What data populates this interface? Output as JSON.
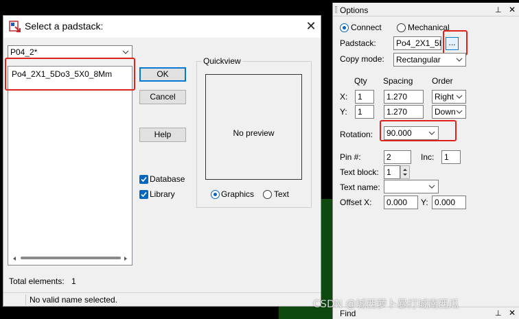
{
  "dialog": {
    "title": "Select a padstack:",
    "filter_value": "P04_2*",
    "list_items": [
      "Po4_2X1_5Do3_5X0_8Mm"
    ],
    "ok_label": "OK",
    "cancel_label": "Cancel",
    "help_label": "Help",
    "database_label": "Database",
    "library_label": "Library",
    "quickview_label": "Quickview",
    "no_preview": "No preview",
    "graphics_label": "Graphics",
    "text_label": "Text",
    "total_label": "Total elements:",
    "total_value": "1",
    "status_text": "No valid name selected.",
    "database_checked": true,
    "library_checked": true,
    "view_mode": "Graphics"
  },
  "options": {
    "title": "Options",
    "connect_label": "Connect",
    "mechanical_label": "Mechanical",
    "mode": "Connect",
    "padstack_label": "Padstack:",
    "padstack_value": "Po4_2X1_5D",
    "browse_label": "...",
    "copy_mode_label": "Copy mode:",
    "copy_mode_value": "Rectangular",
    "qty_header": "Qty",
    "spacing_header": "Spacing",
    "order_header": "Order",
    "x_label": "X:",
    "y_label": "Y:",
    "x_qty": "1",
    "y_qty": "1",
    "x_spacing": "1.270",
    "y_spacing": "1.270",
    "x_order": "Right",
    "y_order": "Down",
    "rotation_label": "Rotation:",
    "rotation_value": "90.000",
    "pin_label": "Pin #:",
    "pin_value": "2",
    "inc_label": "Inc:",
    "inc_value": "1",
    "text_block_label": "Text block:",
    "text_block_value": "1",
    "text_name_label": "Text name:",
    "text_name_value": "",
    "offset_x_label": "Offset X:",
    "offset_x_value": "0.000",
    "offset_y_label": "Y:",
    "offset_y_value": "0.000"
  },
  "find_label": "Find",
  "watermark": "CSDN @城西萝卜暴打城南西瓜",
  "colors": {
    "accent": "#0067c0",
    "highlight_red": "#e0201a",
    "board_green": "#0e4a10"
  }
}
